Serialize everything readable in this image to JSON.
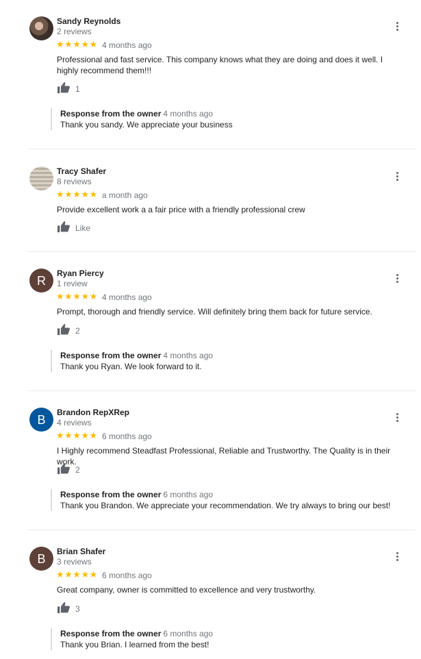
{
  "reviews": [
    {
      "name": "Sandy Reynolds",
      "review_count": "2 reviews",
      "stars": "★★★★★",
      "rating": 5,
      "time": "4 months ago",
      "text": "Professional and fast service. This company knows what they are doing and does it well. I highly recommend them!!!",
      "likes": "1",
      "avatar": "photo",
      "response": {
        "label": "Response from the owner",
        "time": "4 months ago",
        "text": "Thank you sandy. We appreciate your business"
      }
    },
    {
      "name": "Tracy Shafer",
      "review_count": "8 reviews",
      "stars": "★★★★★",
      "rating": 5,
      "time": "a month ago",
      "text": "Provide excellent work a a fair price with a friendly professional crew",
      "likes": "Like",
      "avatar": "photo"
    },
    {
      "name": "Ryan Piercy",
      "review_count": "1 review",
      "stars": "★★★★★",
      "rating": 5,
      "time": "4 months ago",
      "text": "Prompt, thorough and friendly service.  Will definitely bring them back for future service.",
      "likes": "2",
      "avatar_letter": "R",
      "avatar_color": "#5d4037",
      "response": {
        "label": "Response from the owner",
        "time": "4 months ago",
        "text": "Thank you Ryan. We look forward to it."
      }
    },
    {
      "name": "Brandon RepXRep",
      "review_count": "4 reviews",
      "stars": "★★★★★",
      "rating": 5,
      "time": "6 months ago",
      "text": "I Highly recommend Steadfast Professional, Reliable and Trustworthy.  The Quality is in their work.",
      "likes": "2",
      "avatar_letter": "B",
      "avatar_color": "#01579b",
      "response": {
        "label": "Response from the owner",
        "time": "6 months ago",
        "text": "Thank you Brandon. We appreciate your recommendation. We try always to bring our best!"
      }
    },
    {
      "name": "Brian Shafer",
      "review_count": "3 reviews",
      "stars": "★★★★★",
      "rating": 5,
      "time": "6 months ago",
      "text": "Great company, owner is committed to excellence and very trustworthy.",
      "likes": "3",
      "avatar_letter": "B",
      "avatar_color": "#5d4037",
      "response": {
        "label": "Response from the owner",
        "time": "6 months ago",
        "text": "Thank you Brian. I learned from the best!"
      }
    }
  ],
  "icons": {
    "like": "thumbs-up-icon",
    "menu": "more-vert-icon"
  },
  "colors": {
    "star": "#fbbc04",
    "muted": "#70757a",
    "icon": "#5f6368"
  }
}
